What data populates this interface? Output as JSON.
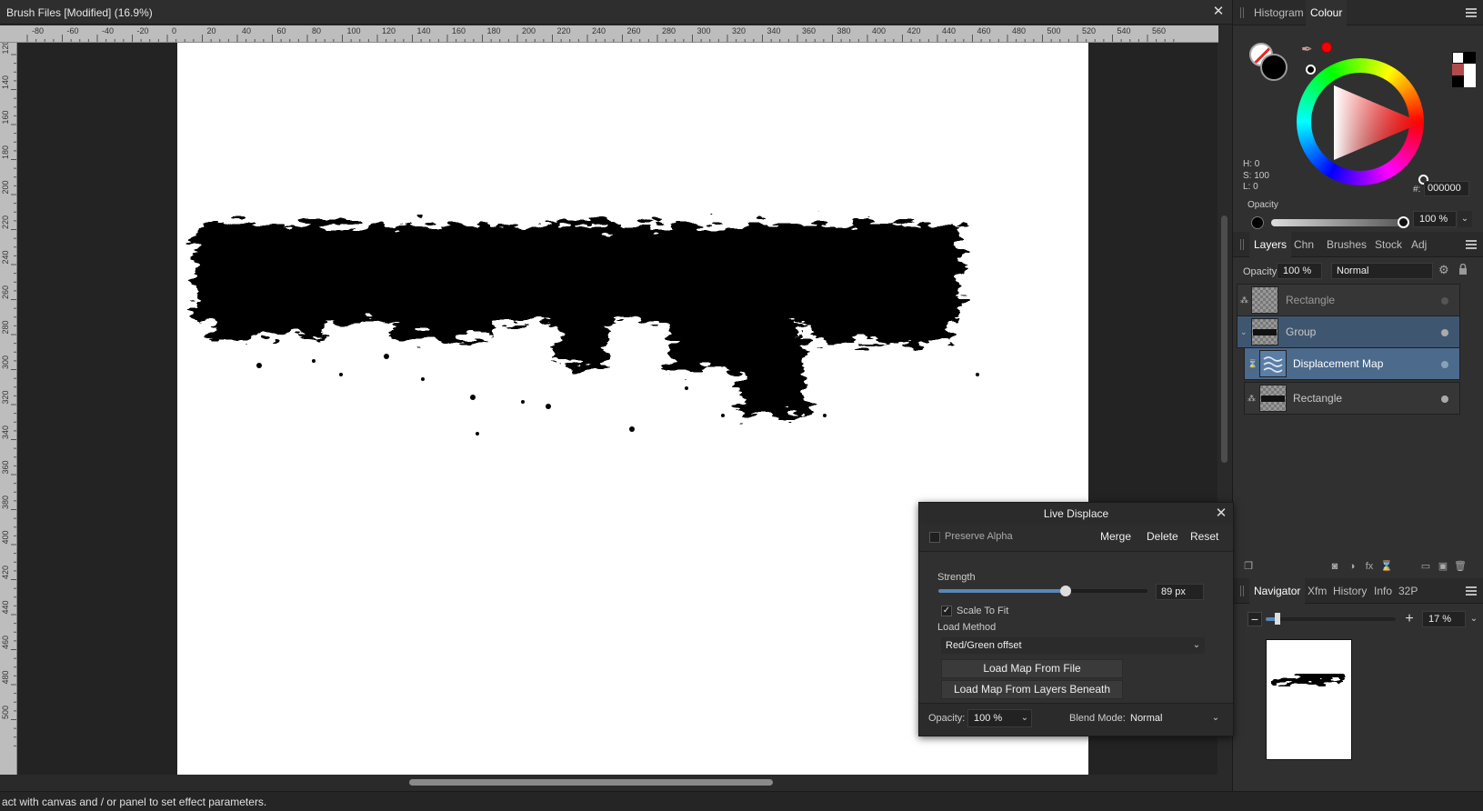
{
  "document": {
    "title": "Brush Files [Modified] (16.9%)",
    "close_glyph": "✕"
  },
  "ruler": {
    "unit": "mm",
    "h_ticks": [
      "-80",
      "-60",
      "-40",
      "-20",
      "0",
      "20",
      "40",
      "60",
      "80",
      "100",
      "120",
      "140",
      "160",
      "180",
      "200",
      "220",
      "240",
      "260",
      "280",
      "300",
      "320",
      "340",
      "360",
      "380",
      "400",
      "420",
      "440",
      "460",
      "480",
      "500",
      "520",
      "540",
      "560"
    ],
    "v_ticks": [
      "120",
      "140",
      "160",
      "180",
      "200",
      "220",
      "240",
      "260",
      "280",
      "300",
      "320",
      "340",
      "360",
      "380",
      "400",
      "420",
      "440",
      "460",
      "480",
      "500"
    ]
  },
  "status": {
    "text": "act with canvas and / or panel to set effect parameters."
  },
  "colour_panel": {
    "tabs": [
      "Histogram",
      "Colour"
    ],
    "active_tab": "Colour",
    "h_label": "H: 0",
    "s_label": "S: 100",
    "l_label": "L: 0",
    "hex_label": "#:",
    "hex_value": "000000",
    "opacity_label": "Opacity",
    "opacity_value": "100 %",
    "accent_color": "#ff0000",
    "swatch_colors": [
      "#ffffff",
      "#000000",
      "#b14a4a",
      "#ffffff",
      "#000000",
      "#ffffff"
    ]
  },
  "layers_panel": {
    "tabs": [
      "Layers",
      "Chn",
      "Brushes",
      "Stock",
      "Adj"
    ],
    "active_tab": "Layers",
    "opacity_label": "Opacity:",
    "opacity_value": "100 %",
    "blend_mode": "Normal",
    "layers": [
      {
        "name": "Rectangle",
        "state": "normal",
        "indent": 0
      },
      {
        "name": "Group",
        "state": "parent-selected",
        "indent": 0
      },
      {
        "name": "Displacement Map",
        "state": "selected",
        "indent": 1
      },
      {
        "name": "Rectangle",
        "state": "normal",
        "indent": 1
      }
    ]
  },
  "navigator_panel": {
    "tabs": [
      "Navigator",
      "Xfm",
      "History",
      "Info",
      "32P"
    ],
    "active_tab": "Navigator",
    "zoom_value": "17 %",
    "minus": "−",
    "plus": "+"
  },
  "live_displace": {
    "title": "Live Displace",
    "close_glyph": "✕",
    "preserve_alpha_label": "Preserve Alpha",
    "preserve_alpha_checked": false,
    "merge_label": "Merge",
    "delete_label": "Delete",
    "reset_label": "Reset",
    "strength_label": "Strength",
    "strength_value": "89 px",
    "strength_fraction": 0.61,
    "scale_to_fit_label": "Scale To Fit",
    "scale_to_fit_checked": true,
    "load_method_label": "Load Method",
    "load_method_value": "Red/Green offset",
    "load_from_file_label": "Load Map From File",
    "load_from_layers_label": "Load Map From Layers Beneath",
    "opacity_label": "Opacity:",
    "opacity_value": "100 %",
    "blend_mode_label": "Blend Mode:",
    "blend_mode_value": "Normal"
  }
}
